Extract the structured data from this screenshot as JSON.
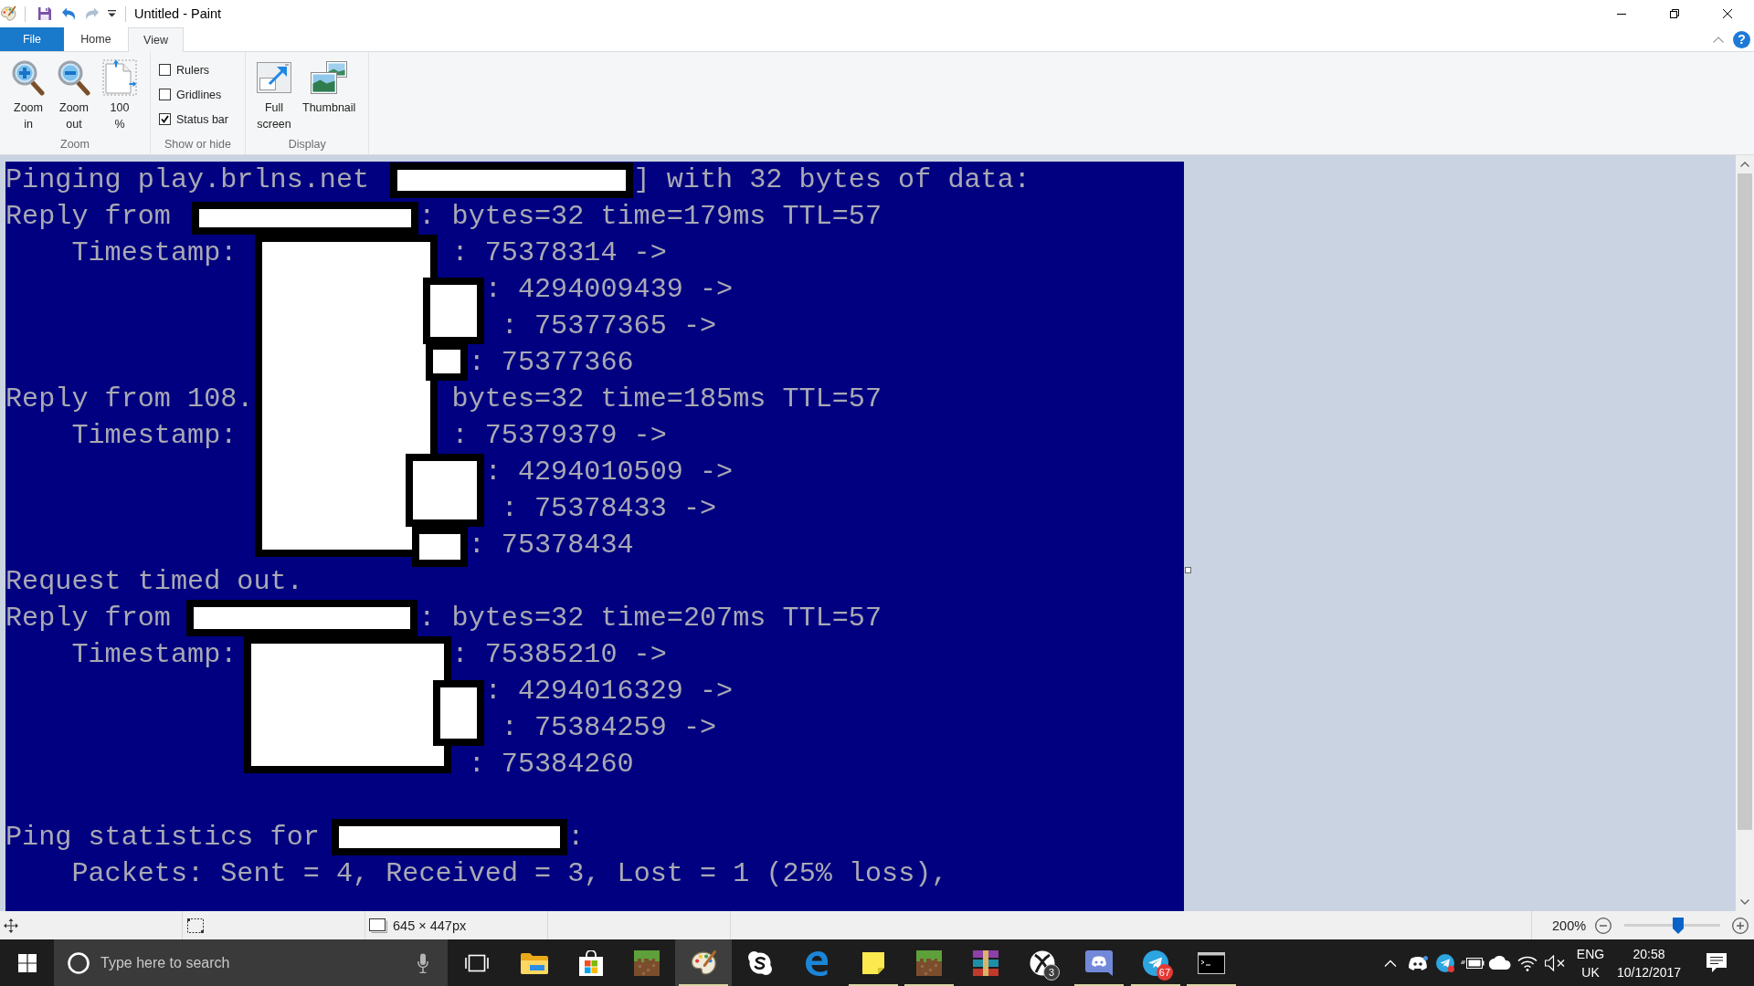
{
  "window": {
    "title": "Untitled - Paint"
  },
  "quick_access": [
    {
      "disabled": false
    },
    {
      "disabled": false
    },
    {
      "disabled": true
    }
  ],
  "ribbon_tabs": [
    {
      "label": "File",
      "kind": "menu",
      "selected": false
    },
    {
      "label": "Home",
      "kind": "tab",
      "selected": false
    },
    {
      "label": "View",
      "kind": "tab",
      "selected": true
    }
  ],
  "help": {
    "label": "?"
  },
  "ribbon_groups": [
    {
      "label": "Zoom",
      "kind": "buttons",
      "controls": [
        {
          "label": "Zoom in"
        },
        {
          "label": "Zoom out"
        },
        {
          "label": "100 %"
        }
      ]
    },
    {
      "label": "Show or hide",
      "kind": "checkboxes",
      "controls": [
        {
          "label": "Rulers",
          "checked": false
        },
        {
          "label": "Gridlines",
          "checked": false
        },
        {
          "label": "Status bar",
          "checked": true
        }
      ]
    },
    {
      "label": "Display",
      "kind": "buttons",
      "controls": [
        {
          "label": "Full screen"
        },
        {
          "label": "Thumbnail"
        }
      ]
    }
  ],
  "canvas": {
    "lines": [
      {
        "segments": [
          "Pinging play.brlns.net",
          "] with 32 bytes of data:"
        ]
      },
      {
        "segments": [
          "Reply from",
          ": bytes=32 time=179ms TTL=57"
        ]
      },
      {
        "segments": [
          "Timestamp:",
          ": 75378314 ->"
        ]
      },
      {
        "segments": [
          ": 4294009439 ->"
        ]
      },
      {
        "segments": [
          ": 75377365 ->"
        ]
      },
      {
        "segments": [
          ": 75377366"
        ]
      },
      {
        "segments": [
          "Reply from 108.",
          "bytes=32 time=185ms TTL=57"
        ]
      },
      {
        "segments": [
          "Timestamp:",
          ": 75379379 ->"
        ]
      },
      {
        "segments": [
          ": 4294010509 ->"
        ]
      },
      {
        "segments": [
          ": 75378433 ->"
        ]
      },
      {
        "segments": [
          ": 75378434"
        ]
      },
      {
        "segments": [
          "Request timed out."
        ]
      },
      {
        "segments": [
          "Reply from",
          ": bytes=32 time=207ms TTL=57"
        ]
      },
      {
        "segments": [
          "Timestamp:",
          ": 75385210 ->"
        ]
      },
      {
        "segments": [
          ": 4294016329 ->"
        ]
      },
      {
        "segments": [
          ": 75384259 ->"
        ]
      },
      {
        "segments": [
          ": 75384260"
        ]
      },
      {
        "segments": [
          "Ping statistics for",
          ":"
        ]
      },
      {
        "segments": [
          "Packets: Sent = 4, Received = 3, Lost = 1 (25% loss),"
        ]
      }
    ]
  },
  "status_bar": {
    "image_size": "645 × 447px",
    "zoom": "200%",
    "zoom_slider": {
      "level": 0.56
    }
  },
  "taskbar": {
    "search": {
      "placeholder": "Type here to search"
    },
    "apps": [
      {
        "running": false,
        "active": false
      },
      {
        "running": false,
        "active": false
      },
      {
        "running": false,
        "active": false
      },
      {
        "running": true,
        "active": true
      },
      {
        "running": false,
        "active": false
      },
      {
        "running": false,
        "active": false
      },
      {
        "running": true,
        "active": false
      },
      {
        "running": true,
        "active": false
      },
      {
        "running": false,
        "active": false
      },
      {
        "running": false,
        "active": false,
        "badge": "3"
      },
      {
        "running": true,
        "active": false
      },
      {
        "running": true,
        "active": false,
        "badge": "67"
      },
      {
        "running": true,
        "active": false
      }
    ],
    "tray": {
      "volume": {
        "muted": true
      },
      "input_language": "ENG",
      "keyboard_layout": "UK",
      "time": "20:58",
      "date": "10/12/2017"
    }
  }
}
